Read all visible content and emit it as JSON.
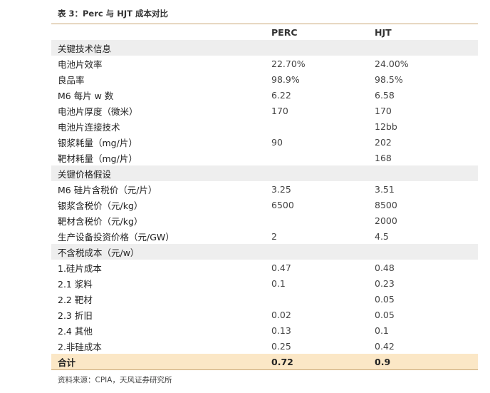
{
  "title": "表 3：Perc 与 HJT 成本对比",
  "columns": [
    "",
    "PERC",
    "HJT"
  ],
  "rows": [
    {
      "type": "section",
      "cells": [
        "关键技术信息",
        "",
        ""
      ]
    },
    {
      "type": "data",
      "cells": [
        "电池片效率",
        "22.70%",
        "24.00%"
      ]
    },
    {
      "type": "data",
      "cells": [
        "良品率",
        "98.9%",
        "98.5%"
      ]
    },
    {
      "type": "data",
      "cells": [
        "M6 每片 w 数",
        "6.22",
        "6.58"
      ]
    },
    {
      "type": "data",
      "cells": [
        "电池片厚度（微米）",
        "170",
        "170"
      ]
    },
    {
      "type": "data",
      "cells": [
        "电池片连接技术",
        "",
        "12bb"
      ]
    },
    {
      "type": "data",
      "cells": [
        "银浆耗量（mg/片）",
        "90",
        "202"
      ]
    },
    {
      "type": "data",
      "cells": [
        "靶材耗量（mg/片）",
        "",
        "168"
      ]
    },
    {
      "type": "section",
      "cells": [
        "关键价格假设",
        "",
        ""
      ]
    },
    {
      "type": "data",
      "cells": [
        "M6 硅片含税价（元/片）",
        "3.25",
        "3.51"
      ]
    },
    {
      "type": "data",
      "cells": [
        "银浆含税价（元/kg）",
        "6500",
        "8500"
      ]
    },
    {
      "type": "data",
      "cells": [
        "靶材含税价（元/kg）",
        "",
        "2000"
      ]
    },
    {
      "type": "data",
      "cells": [
        "生产设备投资价格（元/GW）",
        "2",
        "4.5"
      ]
    },
    {
      "type": "section",
      "cells": [
        "不含税成本（元/w）",
        "",
        ""
      ]
    },
    {
      "type": "data",
      "cells": [
        "1.硅片成本",
        "0.47",
        "0.48"
      ]
    },
    {
      "type": "data",
      "cells": [
        "2.1 浆料",
        "0.1",
        "0.23"
      ]
    },
    {
      "type": "data",
      "cells": [
        "2.2 靶材",
        "",
        "0.05"
      ]
    },
    {
      "type": "data",
      "cells": [
        "2.3 折旧",
        "0.02",
        "0.05"
      ]
    },
    {
      "type": "data",
      "cells": [
        "2.4 其他",
        "0.13",
        "0.1"
      ]
    },
    {
      "type": "data",
      "cells": [
        "2.非硅成本",
        "0.25",
        "0.42"
      ]
    },
    {
      "type": "total",
      "cells": [
        "合计",
        "0.72",
        "0.9"
      ]
    }
  ],
  "source": "资料来源：CPIA，天风证券研究所",
  "colors": {
    "rule": "#c9a877",
    "section_bg": "#eeeeee",
    "total_bg": "#fbe7c6"
  }
}
